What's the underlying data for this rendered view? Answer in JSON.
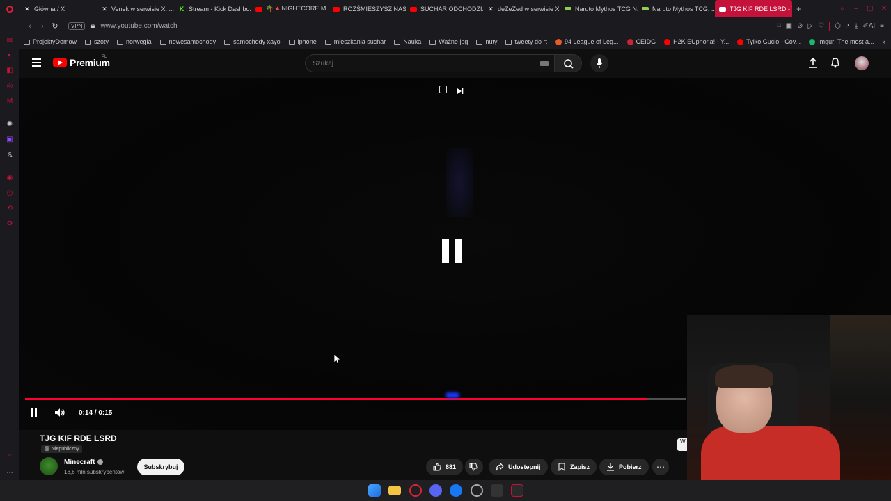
{
  "browser": {
    "tabs": [
      {
        "label": "Główna / X",
        "icon": "x-icon",
        "color": "#ffffff"
      },
      {
        "label": "Venek w serwisie X: ...",
        "icon": "x-icon",
        "color": "#ffffff"
      },
      {
        "label": "Stream - Kick Dashbo...",
        "icon": "kick-icon",
        "color": "#53fc18"
      },
      {
        "label": "🌴🔺NIGHTCORE M...",
        "icon": "youtube-icon",
        "color": "#ff0000"
      },
      {
        "label": "ROZŚMIESZYSZ NAS...",
        "icon": "youtube-icon",
        "color": "#ff0000"
      },
      {
        "label": "SUCHAR ODCHODZI...",
        "icon": "youtube-icon",
        "color": "#ff0000"
      },
      {
        "label": "deZeZed w serwisie X...",
        "icon": "x-icon",
        "color": "#ffffff"
      },
      {
        "label": "Naruto Mythos TCG N...",
        "icon": "site-icon",
        "color": "#8fd14f"
      },
      {
        "label": "Naruto Mythos TCG, ...",
        "icon": "site-icon",
        "color": "#8fd14f"
      },
      {
        "label": "TJG KIF RDE LSRD - Y...",
        "icon": "youtube-icon",
        "color": "#ffffff",
        "active": true
      }
    ],
    "url": "www.youtube.com/watch",
    "vpn_label": "VPN",
    "ai_label": "AI",
    "bookmarks": [
      {
        "label": "ProjektyDomow",
        "type": "folder"
      },
      {
        "label": "szoty",
        "type": "folder"
      },
      {
        "label": "norwegia",
        "type": "folder"
      },
      {
        "label": "nowesamochody",
        "type": "folder"
      },
      {
        "label": "samochody xayo",
        "type": "folder"
      },
      {
        "label": "iphone",
        "type": "folder"
      },
      {
        "label": "mieszkania suchar",
        "type": "folder"
      },
      {
        "label": "Nauka",
        "type": "folder"
      },
      {
        "label": "Ważne jpg",
        "type": "folder"
      },
      {
        "label": "nuty",
        "type": "folder"
      },
      {
        "label": "tweety do rt",
        "type": "folder"
      },
      {
        "label": "94 League of Leg...",
        "type": "site",
        "color": "#e85b2a"
      },
      {
        "label": "CEIDG",
        "type": "site",
        "color": "#cc2233"
      },
      {
        "label": "H2K EUphoria! - Y...",
        "type": "site",
        "color": "#ff0000"
      },
      {
        "label": "Tylko Gucio - Cov...",
        "type": "site",
        "color": "#ff0000"
      },
      {
        "label": "Imgur: The most a...",
        "type": "site",
        "color": "#1bb76e"
      }
    ]
  },
  "youtube": {
    "brand": "Premium",
    "region": "PL",
    "search_placeholder": "Szukaj",
    "video": {
      "time": "0:14 / 0:15",
      "progress": 0.94,
      "title": "TJG KIF RDE LSRD",
      "visibility": "Niepubliczny"
    },
    "channel": {
      "name": "Minecraft",
      "subscribers": "18,6 mln subskrybentów",
      "subscribe_label": "Subskrybuj"
    },
    "actions": {
      "likes": "881",
      "share": "Udostępnij",
      "save": "Zapisz",
      "download": "Pobierz"
    },
    "side_chip": "W"
  },
  "colors": {
    "accent": "#ff0033",
    "opera_red": "#c4123a",
    "background": "#0f0f0f"
  }
}
